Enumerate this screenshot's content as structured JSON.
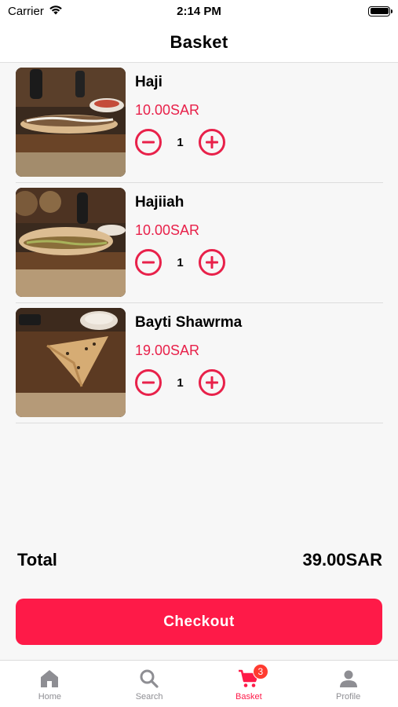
{
  "status_bar": {
    "carrier": "Carrier",
    "time": "2:14 PM"
  },
  "nav": {
    "title": "Basket"
  },
  "basket": {
    "items": [
      {
        "name": "Haji",
        "price": "10.00SAR",
        "quantity": "1",
        "image": "sandwich-photo"
      },
      {
        "name": "Hajiiah",
        "price": "10.00SAR",
        "quantity": "1",
        "image": "sandwich-photo"
      },
      {
        "name": "Bayti Shawrma",
        "price": "19.00SAR",
        "quantity": "1",
        "image": "shawarma-photo"
      }
    ]
  },
  "summary": {
    "total_label": "Total",
    "total_value": "39.00SAR"
  },
  "checkout": {
    "label": "Checkout"
  },
  "tab_bar": {
    "tabs": [
      {
        "label": "Home",
        "icon": "home-icon",
        "active": false
      },
      {
        "label": "Search",
        "icon": "search-icon",
        "active": false
      },
      {
        "label": "Basket",
        "icon": "cart-icon",
        "active": true,
        "badge": "3"
      },
      {
        "label": "Profile",
        "icon": "profile-icon",
        "active": false
      }
    ]
  },
  "colors": {
    "accent": "#fe1a48",
    "price": "#e8214a",
    "badge": "#ff3b30",
    "inactive_tab": "#8e8e93"
  }
}
